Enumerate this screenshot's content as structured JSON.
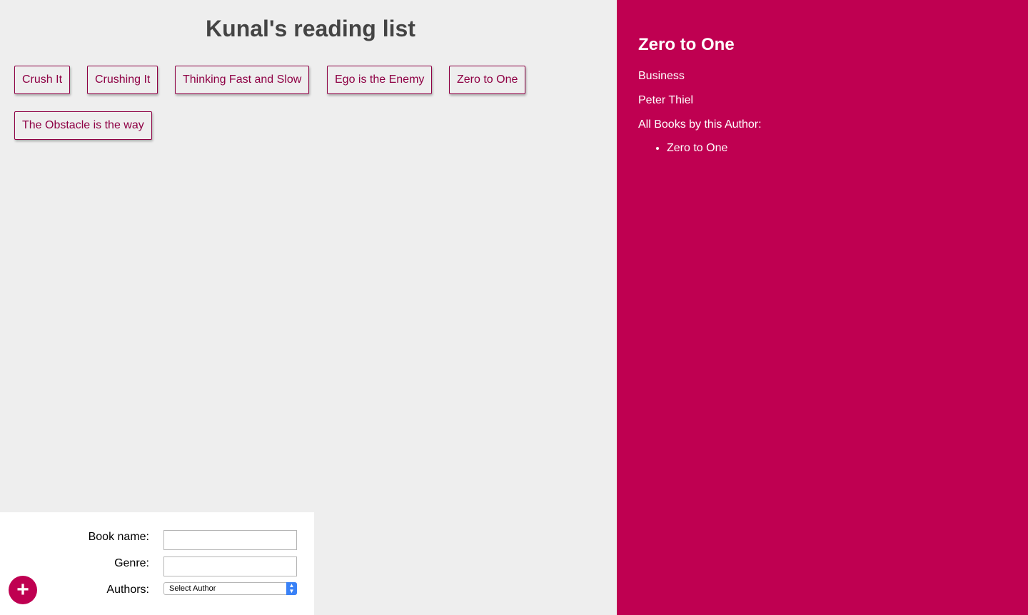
{
  "page": {
    "title": "Kunal's reading list"
  },
  "books": [
    "Crush It",
    "Crushing It",
    "Thinking Fast and Slow",
    "Ego is the Enemy",
    "Zero to One",
    "The Obstacle is the way"
  ],
  "details": {
    "title": "Zero to One",
    "genre": "Business",
    "author": "Peter Thiel",
    "all_books_label": "All Books by this Author:",
    "author_books": [
      "Zero to One"
    ]
  },
  "form": {
    "book_name_label": "Book name:",
    "book_name_value": "",
    "genre_label": "Genre:",
    "genre_value": "",
    "authors_label": "Authors:",
    "authors_selected": "Select Author"
  },
  "add_button": {
    "icon": "plus-icon",
    "glyph": "+"
  },
  "colors": {
    "accent": "#bf0051",
    "book_text": "#8e0044",
    "main_bg": "#eeeeee",
    "title_text": "#444444"
  }
}
